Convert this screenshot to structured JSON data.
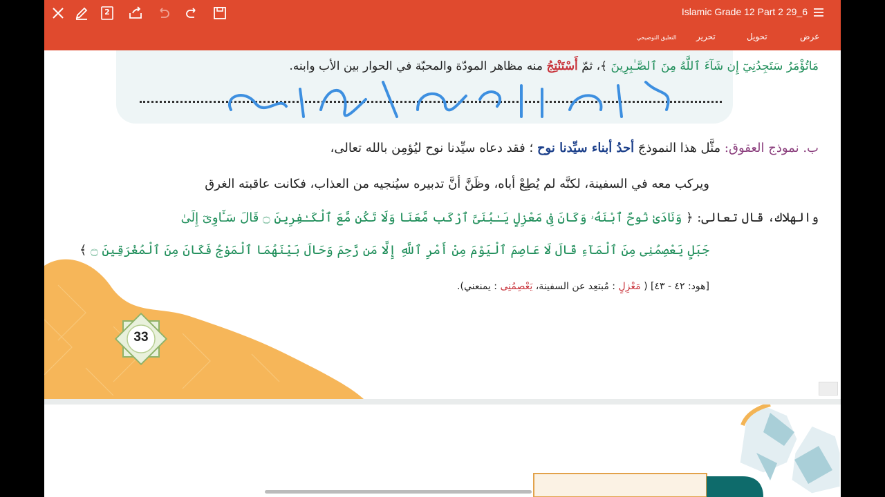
{
  "toolbar": {
    "doc_title": "Islamic Grade 12 Part 2 29_6",
    "page_count_badge": "2",
    "tabs": [
      "عرض",
      "تحويل",
      "تحرير",
      "التعليق التوضيحي"
    ],
    "icons": [
      "close-icon",
      "pen-icon",
      "page-count-icon",
      "share-icon",
      "undo-icon",
      "redo-icon",
      "save-icon",
      "menu-icon"
    ],
    "color": "#e04a2e"
  },
  "page": {
    "activity": {
      "line1_quote": "مَاتُؤْمَرُ سَتَجِدُنِيٓ إِن شَآءَ ٱللَّهُ مِنَ ٱلصَّـٰبِرِينَ",
      "line1_pre": "﴾، ثمّ",
      "line1_keyword": "أَسْتَنْتِجُ",
      "line1_post": "منه مظاهر المودّة والمحبّة في الحوار بين الأب وابنه.",
      "handwriting": "احسان / طاعة الابن"
    },
    "section_b": {
      "label": "ب. نموذج العقوق:",
      "line1_a": "مثَّل هذا النموذجَ",
      "line1_b": "أحدُ أبناء سيِّدنا نوح",
      "line1_c": "؛ فقد دعاه سيِّدنا نوح",
      "line1_d": "ليُؤمِن بالله تعالى،",
      "line2": "ويركب معه في السفينة، لكنَّه لم يُطِعْ أباه، وظَنَّ أنَّ تدبيره سيُنجيه من العذاب، فكانت عاقبته الغرق",
      "line3_pre": "والهلاك، قال تعالى: ﴿",
      "line3_quote": "وَنَادَىٰ نُوحٌ ٱبْنَهُۥ وَكَانَ فِى مَعْزِلٍ يَـٰبُنَىَّ ٱرْكَب مَّعَنَا وَلَا تَكُن مَّعَ ٱلْكَـٰفِرِينَ ۝ قَالَ سَـَٔاوِىٓ إِلَىٰ",
      "line4_quote": "جَبَلٍ يَعْصِمُنِى مِنَ ٱلْمَآءِ قَالَ لَا عَاصِمَ ٱلْيَوْمَ مِنْ أَمْرِ ٱللَّهِ إِلَّا مَن رَّحِمَ وَحَالَ بَيْنَهُمَا ٱلْمَوْجُ فَكَانَ مِنَ ٱلْمُغْرَقِينَ ۝",
      "line4_close": "﴾",
      "ref_a": "[هود: ٤٢ - ٤٣] (",
      "ref_w1": "مَعْزِلٍ",
      "ref_b": ": مُبتعِد عن السفينة،",
      "ref_w2": "يَعْصِمُنِى",
      "ref_c": ": يمنعني)."
    },
    "page_number": "33"
  }
}
